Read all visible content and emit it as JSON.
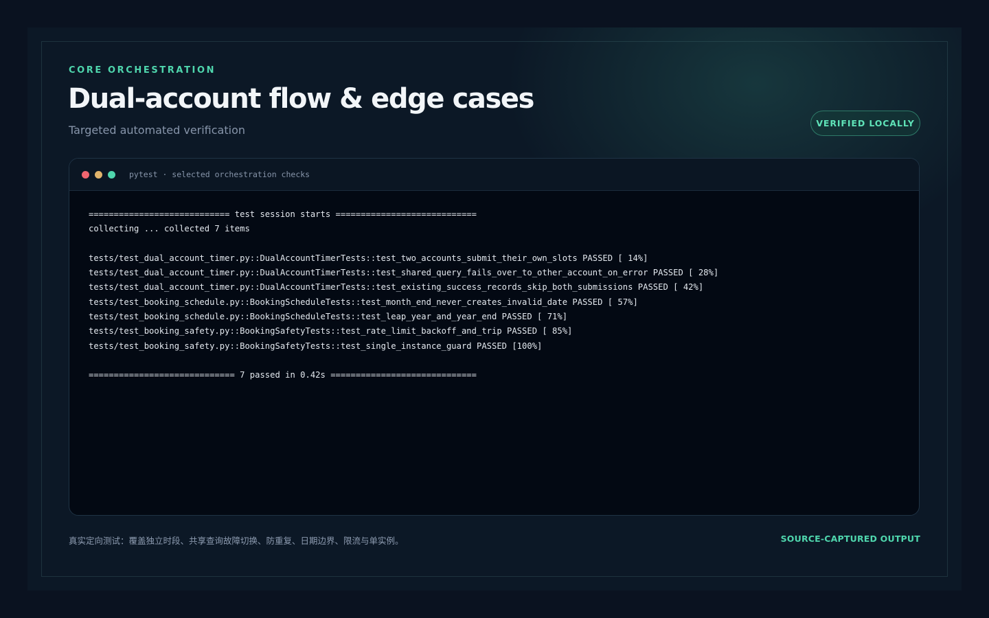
{
  "header": {
    "eyebrow": "CORE ORCHESTRATION",
    "title": "Dual-account flow & edge cases",
    "subtitle": "Targeted automated verification",
    "badge": "VERIFIED LOCALLY"
  },
  "terminal": {
    "title": "pytest · selected orchestration checks",
    "dots": [
      "#f06570",
      "#e0b36b",
      "#4fd6ad"
    ],
    "lines": [
      "============================ test session starts ============================",
      "collecting ... collected 7 items",
      "",
      "tests/test_dual_account_timer.py::DualAccountTimerTests::test_two_accounts_submit_their_own_slots PASSED [ 14%]",
      "tests/test_dual_account_timer.py::DualAccountTimerTests::test_shared_query_fails_over_to_other_account_on_error PASSED [ 28%]",
      "tests/test_dual_account_timer.py::DualAccountTimerTests::test_existing_success_records_skip_both_submissions PASSED [ 42%]",
      "tests/test_booking_schedule.py::BookingScheduleTests::test_month_end_never_creates_invalid_date PASSED [ 57%]",
      "tests/test_booking_schedule.py::BookingScheduleTests::test_leap_year_and_year_end PASSED [ 71%]",
      "tests/test_booking_safety.py::BookingSafetyTests::test_rate_limit_backoff_and_trip PASSED [ 85%]",
      "tests/test_booking_safety.py::BookingSafetyTests::test_single_instance_guard PASSED [100%]",
      "",
      "============================= 7 passed in 0.42s ============================="
    ]
  },
  "footer": {
    "note": "真实定向测试：覆盖独立时段、共享查询故障切换、防重复、日期边界、限流与单实例。",
    "tag": "SOURCE-CAPTURED OUTPUT"
  },
  "colors": {
    "accent": "#4fd6ad",
    "background": "#0a1220",
    "terminal_background": "#030913"
  }
}
